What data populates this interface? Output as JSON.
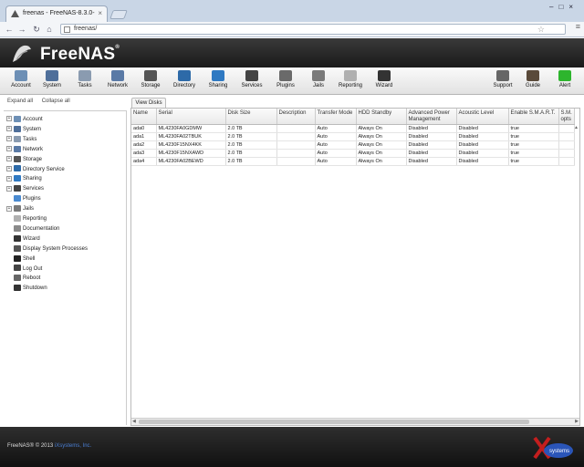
{
  "browser": {
    "tab_title": "freenas - FreeNAS-8.3.0-",
    "url": "freenas/"
  },
  "app": {
    "logo": "FreeNAS",
    "logo_reg": "®"
  },
  "toolbar": {
    "left": [
      {
        "label": "Account",
        "icon": "account-icon",
        "color": "#6d8fb5"
      },
      {
        "label": "System",
        "icon": "system-icon",
        "color": "#4f6f9a"
      },
      {
        "label": "Tasks",
        "icon": "tasks-icon",
        "color": "#8a9bb0"
      },
      {
        "label": "Network",
        "icon": "network-icon",
        "color": "#5a7aa6"
      },
      {
        "label": "Storage",
        "icon": "storage-icon",
        "color": "#555555"
      },
      {
        "label": "Directory",
        "icon": "directory-icon",
        "color": "#2d6aa8"
      },
      {
        "label": "Sharing",
        "icon": "sharing-icon",
        "color": "#2f79c2"
      },
      {
        "label": "Services",
        "icon": "services-icon",
        "color": "#444444"
      },
      {
        "label": "Plugins",
        "icon": "plugins-icon",
        "color": "#6a6a6a"
      },
      {
        "label": "Jails",
        "icon": "jails-icon",
        "color": "#7a7a7a"
      },
      {
        "label": "Reporting",
        "icon": "reporting-icon",
        "color": "#b0b0b0"
      },
      {
        "label": "Wizard",
        "icon": "wizard-icon",
        "color": "#333333"
      }
    ],
    "right": [
      {
        "label": "Support",
        "icon": "support-icon",
        "color": "#666666"
      },
      {
        "label": "Guide",
        "icon": "guide-icon",
        "color": "#5a4a3a"
      },
      {
        "label": "Alert",
        "icon": "alert-icon",
        "color": "#2db52d"
      }
    ]
  },
  "tree": {
    "expand_all": "Expand all",
    "collapse_all": "Collapse all",
    "items": [
      {
        "label": "Account",
        "icon": "account-icon",
        "expandable": true,
        "color": "#6d8fb5"
      },
      {
        "label": "System",
        "icon": "system-icon",
        "expandable": true,
        "color": "#4f6f9a"
      },
      {
        "label": "Tasks",
        "icon": "tasks-icon",
        "expandable": true,
        "color": "#8a9bb0"
      },
      {
        "label": "Network",
        "icon": "network-icon",
        "expandable": true,
        "color": "#5a7aa6"
      },
      {
        "label": "Storage",
        "icon": "storage-icon",
        "expandable": true,
        "color": "#555555"
      },
      {
        "label": "Directory Service",
        "icon": "directory-icon",
        "expandable": true,
        "color": "#2d6aa8"
      },
      {
        "label": "Sharing",
        "icon": "sharing-icon",
        "expandable": true,
        "color": "#2f79c2"
      },
      {
        "label": "Services",
        "icon": "services-icon",
        "expandable": true,
        "color": "#444444"
      },
      {
        "label": "Plugins",
        "icon": "plugins-icon",
        "expandable": false,
        "color": "#4a8ad0"
      },
      {
        "label": "Jails",
        "icon": "jails-icon",
        "expandable": true,
        "color": "#7a7a7a"
      },
      {
        "label": "Reporting",
        "icon": "reporting-icon",
        "expandable": false,
        "color": "#b0b0b0"
      },
      {
        "label": "Documentation",
        "icon": "documentation-icon",
        "expandable": false,
        "color": "#8a8a8a"
      },
      {
        "label": "Wizard",
        "icon": "wizard-icon",
        "expandable": false,
        "color": "#333333"
      },
      {
        "label": "Display System Processes",
        "icon": "processes-icon",
        "expandable": false,
        "color": "#555555"
      },
      {
        "label": "Shell",
        "icon": "shell-icon",
        "expandable": false,
        "color": "#222222"
      },
      {
        "label": "Log Out",
        "icon": "logout-icon",
        "expandable": false,
        "color": "#444444"
      },
      {
        "label": "Reboot",
        "icon": "reboot-icon",
        "expandable": false,
        "color": "#666666"
      },
      {
        "label": "Shutdown",
        "icon": "shutdown-icon",
        "expandable": false,
        "color": "#333333"
      }
    ]
  },
  "view_tab": "View Disks",
  "grid": {
    "columns": [
      "Name",
      "Serial",
      "Disk Size",
      "Description",
      "Transfer Mode",
      "HDD Standby",
      "Advanced Power Management",
      "Acoustic Level",
      "Enable S.M.A.R.T.",
      "S.M. opts"
    ],
    "rows": [
      [
        "ada0",
        "ML4230FA0GDMW",
        "2.0 TB",
        "",
        "Auto",
        "Always On",
        "Disabled",
        "Disabled",
        "true",
        ""
      ],
      [
        "ada1",
        "ML4230FA02TBUK",
        "2.0 TB",
        "",
        "Auto",
        "Always On",
        "Disabled",
        "Disabled",
        "true",
        ""
      ],
      [
        "ada2",
        "ML4230F15NX4KK",
        "2.0 TB",
        "",
        "Auto",
        "Always On",
        "Disabled",
        "Disabled",
        "true",
        ""
      ],
      [
        "ada3",
        "ML4230F15NXAWD",
        "2.0 TB",
        "",
        "Auto",
        "Always On",
        "Disabled",
        "Disabled",
        "true",
        ""
      ],
      [
        "ada4",
        "ML4230FA02BEWD",
        "2.0 TB",
        "",
        "Auto",
        "Always On",
        "Disabled",
        "Disabled",
        "true",
        ""
      ]
    ]
  },
  "footer": {
    "text": "FreeNAS® © 2013",
    "link": "iXsystems, Inc."
  },
  "footer_logo": "systems"
}
